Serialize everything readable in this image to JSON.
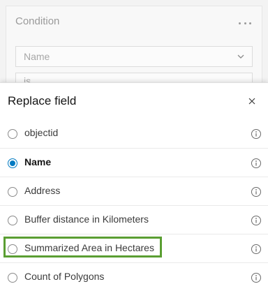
{
  "condition": {
    "title": "Condition",
    "field_value": "Name",
    "operator_value": "is"
  },
  "replace_field": {
    "title": "Replace field",
    "selected_index": 1,
    "options": [
      {
        "label": "objectid"
      },
      {
        "label": "Name"
      },
      {
        "label": "Address"
      },
      {
        "label": "Buffer distance in Kilometers"
      },
      {
        "label": "Summarized Area in Hectares"
      },
      {
        "label": "Count of Polygons"
      }
    ],
    "highlighted_index": 4
  },
  "colors": {
    "accent": "#007ac2",
    "highlight": "#5a9e32"
  }
}
